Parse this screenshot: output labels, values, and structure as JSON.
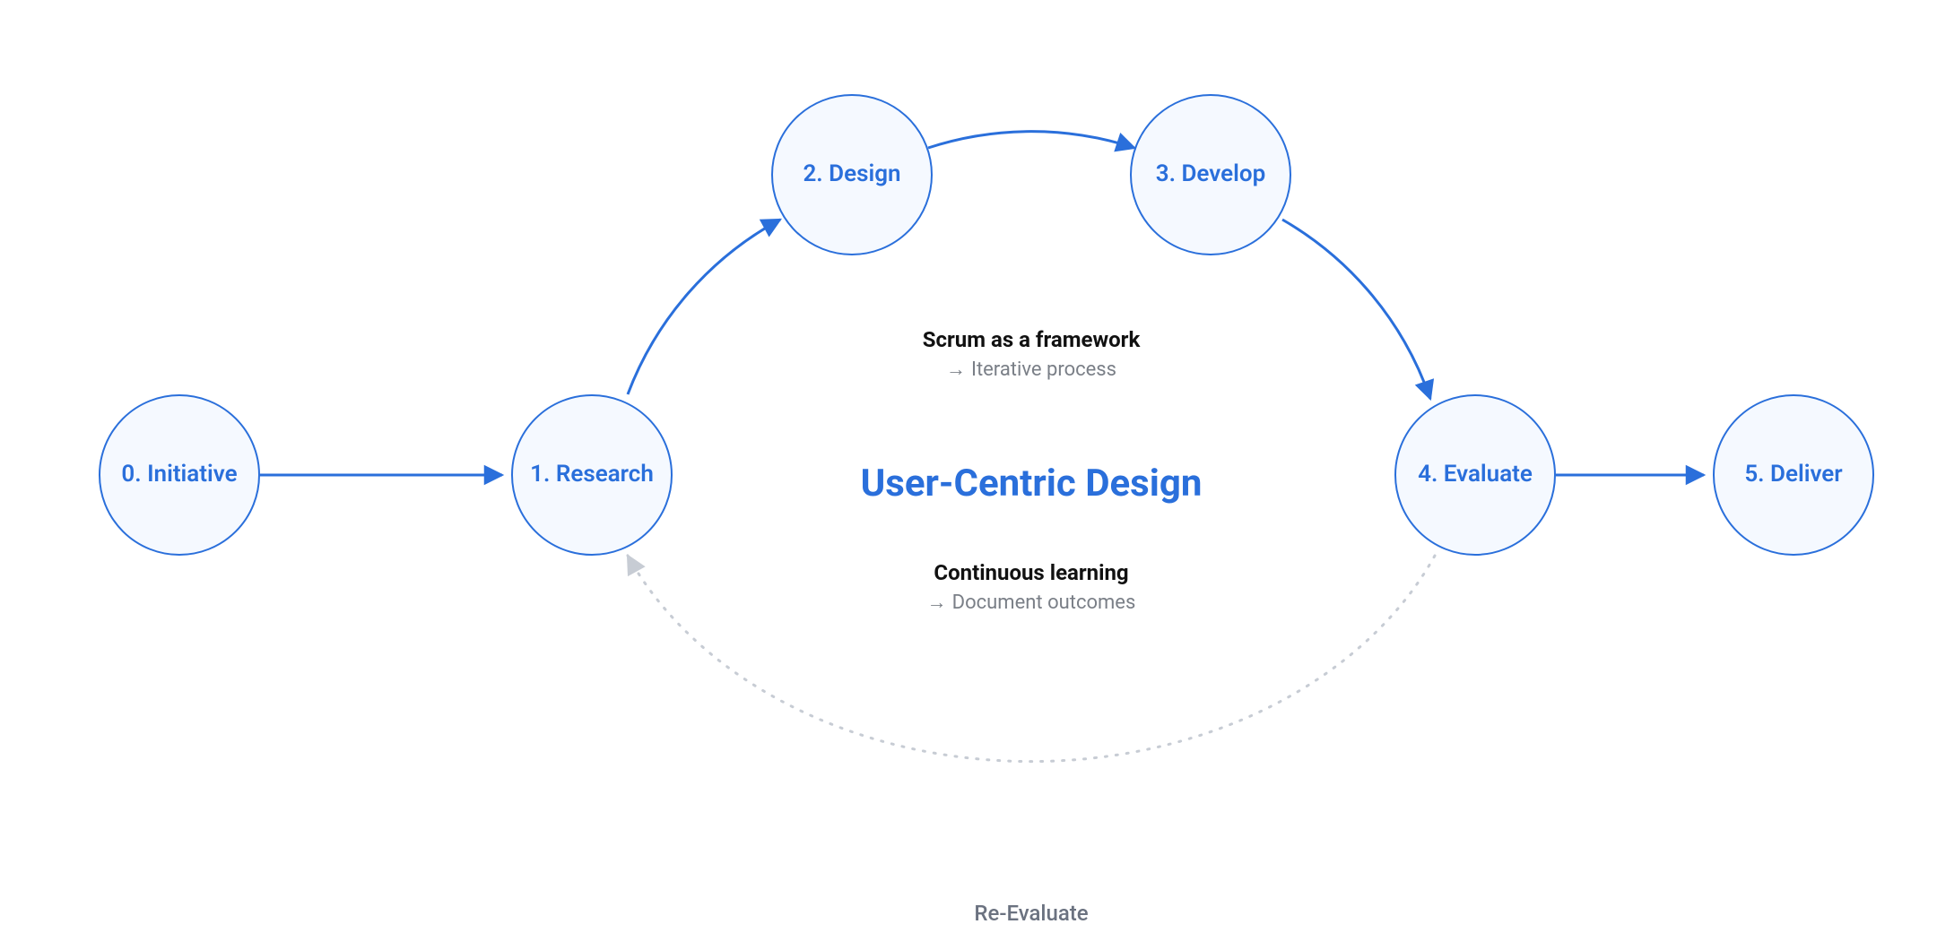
{
  "diagram": {
    "title": "User-Centric Design",
    "nodes": {
      "n0": "0. Initiative",
      "n1": "1. Research",
      "n2": "2. Design",
      "n3": "3. Develop",
      "n4": "4. Evaluate",
      "n5": "5. Deliver"
    },
    "top_note": {
      "heading": "Scrum as a framework",
      "sub": "Iterative process"
    },
    "bottom_note": {
      "heading": "Continuous learning",
      "sub": "Document outcomes"
    },
    "return_label": "Re-Evaluate",
    "colors": {
      "accent": "#2a6fdb",
      "node_fill": "#f5f9ff",
      "muted": "#7a7f87",
      "dotted": "#c7ccd4"
    }
  }
}
